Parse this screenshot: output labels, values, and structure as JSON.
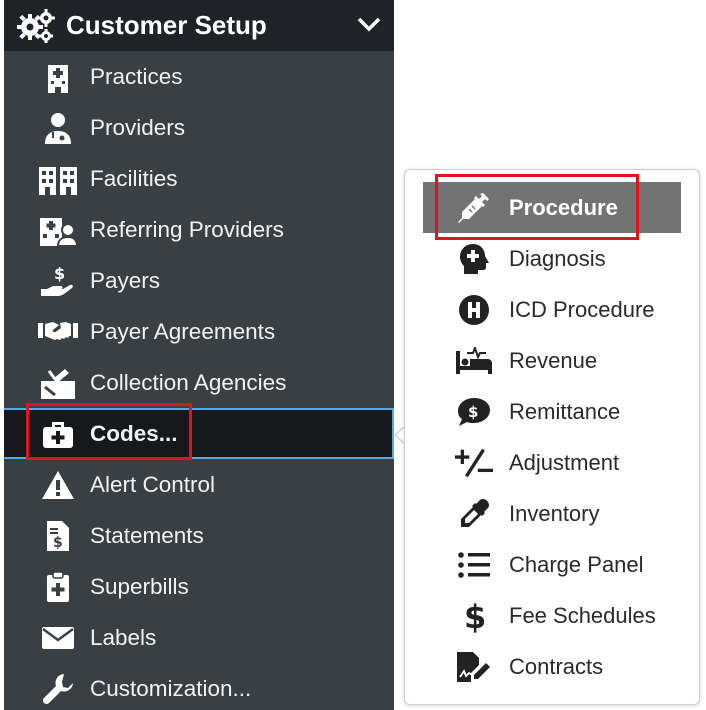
{
  "header": {
    "title": "Customer Setup",
    "icon": "gears-icon"
  },
  "menu": {
    "items": [
      {
        "label": "Practices",
        "icon": "hospital-icon"
      },
      {
        "label": "Providers",
        "icon": "doctor-icon"
      },
      {
        "label": "Facilities",
        "icon": "buildings-icon"
      },
      {
        "label": "Referring Providers",
        "icon": "hospital-user-icon"
      },
      {
        "label": "Payers",
        "icon": "hand-dollar-icon"
      },
      {
        "label": "Payer Agreements",
        "icon": "handshake-icon"
      },
      {
        "label": "Collection Agencies",
        "icon": "sign-icon"
      },
      {
        "label": "Codes...",
        "icon": "medkit-icon"
      },
      {
        "label": "Alert Control",
        "icon": "warning-icon"
      },
      {
        "label": "Statements",
        "icon": "invoice-icon"
      },
      {
        "label": "Superbills",
        "icon": "clipboard-plus-icon"
      },
      {
        "label": "Labels",
        "icon": "envelope-icon"
      },
      {
        "label": "Customization...",
        "icon": "wrench-icon"
      }
    ]
  },
  "submenu": {
    "items": [
      {
        "label": "Procedure",
        "icon": "syringe-icon"
      },
      {
        "label": "Diagnosis",
        "icon": "head-plus-icon"
      },
      {
        "label": "ICD Procedure",
        "icon": "h-circle-icon"
      },
      {
        "label": "Revenue",
        "icon": "bed-pulse-icon"
      },
      {
        "label": "Remittance",
        "icon": "dollar-bubble-icon"
      },
      {
        "label": "Adjustment",
        "icon": "plus-minus-icon"
      },
      {
        "label": "Inventory",
        "icon": "eyedropper-icon"
      },
      {
        "label": "Charge Panel",
        "icon": "list-icon"
      },
      {
        "label": "Fee Schedules",
        "icon": "dollar-icon"
      },
      {
        "label": "Contracts",
        "icon": "file-signature-icon"
      }
    ]
  },
  "colors": {
    "menu_bg": "#3a3f44",
    "header_bg": "#1f2226",
    "active_border": "#5aa9e6",
    "highlight": "#e0141a",
    "selected_bg": "#737373"
  }
}
